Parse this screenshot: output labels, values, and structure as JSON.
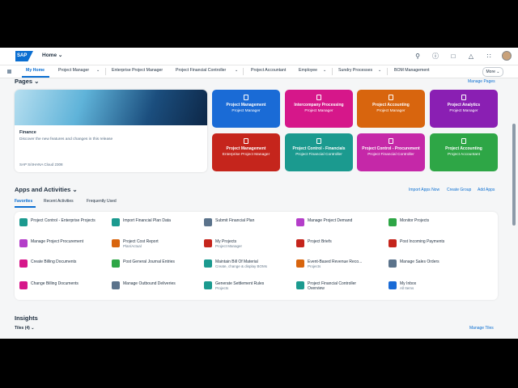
{
  "shell": {
    "logo": "SAP",
    "home_menu": "Home ⌄",
    "icons": [
      "search-icon",
      "help-icon",
      "chat-icon",
      "notifications-icon",
      "grid-icon",
      "avatar"
    ]
  },
  "tabs": [
    {
      "label": "My Home",
      "active": true
    },
    {
      "label": "Project Manager",
      "chev": true
    },
    {
      "label": "Enterprise Project Manager"
    },
    {
      "label": "Project Financial Controller",
      "chev": true
    },
    {
      "label": "Project Accountant"
    },
    {
      "label": "Employee",
      "chev": true
    },
    {
      "label": "Sundry Processes",
      "chev": true
    },
    {
      "label": "BOM Management"
    }
  ],
  "more": "More ⌄",
  "pages": {
    "title": "Pages ⌄",
    "manage": "Manage Pages",
    "hero": {
      "title": "Finance",
      "desc": "Discover the new features and changes in this release",
      "foot": "SAP S/4HANA Cloud 2308"
    },
    "tiles": [
      {
        "title": "Project Management",
        "sub": "Project Manager",
        "color": "#1a6bd6"
      },
      {
        "title": "Intercompany Processing",
        "sub": "Project Manager",
        "color": "#d6178a"
      },
      {
        "title": "Project Accounting",
        "sub": "Project Manager",
        "color": "#d8650e"
      },
      {
        "title": "Project Analytics",
        "sub": "Project Manager",
        "color": "#8a1fb3"
      },
      {
        "title": "Project Management",
        "sub": "Enterprise Project Manager",
        "color": "#c5251c"
      },
      {
        "title": "Project Control - Financials",
        "sub": "Project Financial Controller",
        "color": "#1b9a8f"
      },
      {
        "title": "Project Control - Procurement",
        "sub": "Project Financial Controller",
        "color": "#c528a8"
      },
      {
        "title": "Project Accounting",
        "sub": "Project Accountant",
        "color": "#2ea646"
      }
    ]
  },
  "apps": {
    "title": "Apps and Activities ⌄",
    "actions": [
      "Import Apps Now",
      "Create Group",
      "Add Apps"
    ],
    "tabs": [
      "Favorites",
      "Recent Activities",
      "Frequently Used"
    ],
    "items": [
      {
        "name": "Project Control - Enterprise Projects",
        "sub": "",
        "color": "#1b9a8f"
      },
      {
        "name": "Import Financial Plan Data",
        "sub": "",
        "color": "#1b9a8f"
      },
      {
        "name": "Submit Financial Plan",
        "sub": "",
        "color": "#5b738b"
      },
      {
        "name": "Manage Project Demand",
        "sub": "",
        "color": "#b43ec9"
      },
      {
        "name": "Monitor Projects",
        "sub": "",
        "color": "#2ea646"
      },
      {
        "name": "Manage Project Procurement",
        "sub": "",
        "color": "#b43ec9"
      },
      {
        "name": "Project Cost Report",
        "sub": "Plan/Actual",
        "color": "#d8650e"
      },
      {
        "name": "My Projects",
        "sub": "Project Manager",
        "color": "#c5251c"
      },
      {
        "name": "Project Briefs",
        "sub": "",
        "color": "#c5251c"
      },
      {
        "name": "Post Incoming Payments",
        "sub": "",
        "color": "#c5251c"
      },
      {
        "name": "Create Billing Documents",
        "sub": "",
        "color": "#d6178a"
      },
      {
        "name": "Post General Journal Entries",
        "sub": "",
        "color": "#2ea646"
      },
      {
        "name": "Maintain Bill Of Material",
        "sub": "Create, change & display BOMs",
        "color": "#1b9a8f"
      },
      {
        "name": "Event-Based Revenue Reco...",
        "sub": "Projects",
        "color": "#d8650e"
      },
      {
        "name": "Manage Sales Orders",
        "sub": "",
        "color": "#5b738b"
      },
      {
        "name": "Change Billing Documents",
        "sub": "",
        "color": "#d6178a"
      },
      {
        "name": "Manage Outbound Deliveries",
        "sub": "",
        "color": "#5b738b"
      },
      {
        "name": "Generate Settlement Rules",
        "sub": "Projects",
        "color": "#1b9a8f"
      },
      {
        "name": "Project Financial Controller Overview",
        "sub": "",
        "color": "#1b9a8f"
      },
      {
        "name": "My Inbox",
        "sub": "All Items",
        "color": "#1a6bd6"
      }
    ]
  },
  "insights": {
    "title": "Insights",
    "tiles_label": "Tiles (4) ⌄",
    "manage": "Manage Tiles"
  }
}
